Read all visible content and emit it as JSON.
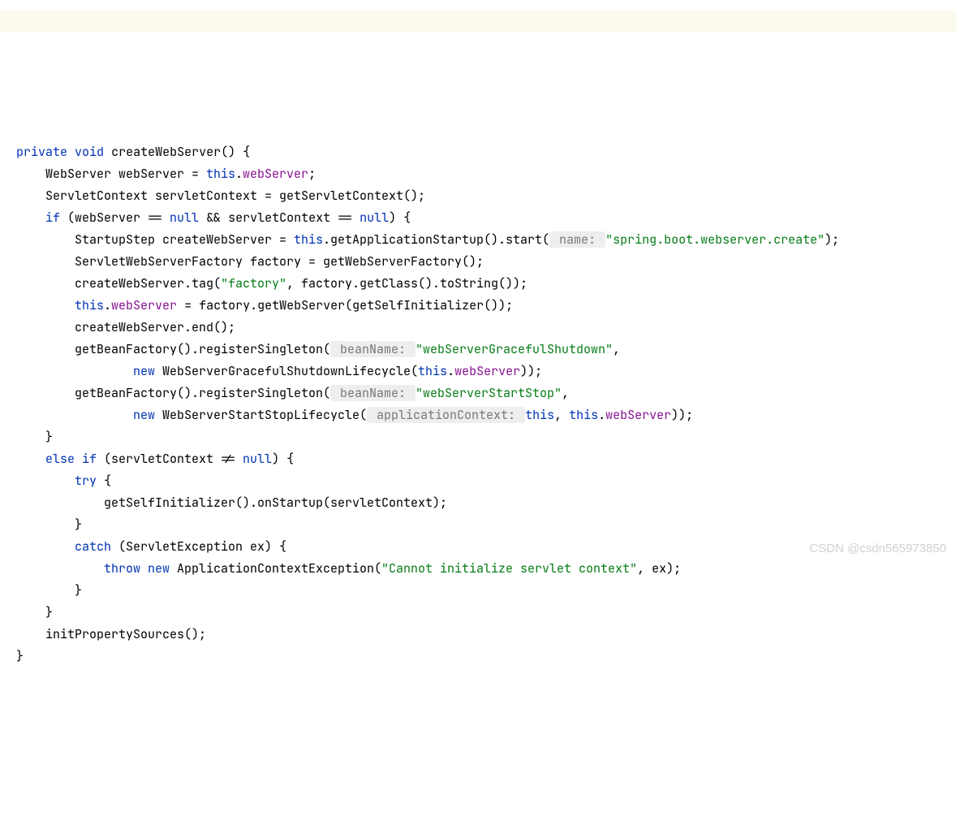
{
  "code": {
    "kw_private": "private",
    "kw_void": "void",
    "method_name": "createWebServer() {",
    "l2_a": "    WebServer webServer = ",
    "l2_kw_this": "this",
    "l2_b": ".",
    "l2_field": "webServer",
    "l2_c": ";",
    "l3": "    ServletContext servletContext = getServletContext();",
    "l4_a": "    ",
    "l4_if": "if",
    "l4_b": " (webServer == ",
    "l4_null1": "null",
    "l4_c": " && servletContext == ",
    "l4_null2": "null",
    "l4_d": ") {",
    "l5_a": "        StartupStep createWebServer = ",
    "l5_this": "this",
    "l5_b": ".getApplicationStartup().start(",
    "l5_hint": " name: ",
    "l5_str": "\"spring.boot.webserver.create\"",
    "l5_c": ");",
    "l6": "        ServletWebServerFactory factory = getWebServerFactory();",
    "l7_a": "        createWebServer.tag(",
    "l7_str": "\"factory\"",
    "l7_b": ", factory.getClass().toString());",
    "l8_a": "        ",
    "l8_this": "this",
    "l8_b": ".",
    "l8_field": "webServer",
    "l8_c": " = factory.getWebServer(getSelfInitializer());",
    "l9": "        createWebServer.end();",
    "l10_a": "        getBeanFactory().registerSingleton(",
    "l10_hint": " beanName: ",
    "l10_str": "\"webServerGracefulShutdown\"",
    "l10_b": ",",
    "l11_a": "                ",
    "l11_new": "new",
    "l11_b": " WebServerGracefulShutdownLifecycle(",
    "l11_this": "this",
    "l11_c": ".",
    "l11_field": "webServer",
    "l11_d": "));",
    "l12_a": "        getBeanFactory().registerSingleton(",
    "l12_hint": " beanName: ",
    "l12_str": "\"webServerStartStop\"",
    "l12_b": ",",
    "l13_a": "                ",
    "l13_new": "new",
    "l13_b": " WebServerStartStopLifecycle(",
    "l13_hint": " applicationContext: ",
    "l13_this1": "this",
    "l13_c": ", ",
    "l13_this2": "this",
    "l13_d": ".",
    "l13_field": "webServer",
    "l13_e": "));",
    "l14": "    }",
    "l15_a": "    ",
    "l15_else": "else if",
    "l15_b": " (servletContext != ",
    "l15_null": "null",
    "l15_c": ") {",
    "l16_a": "        ",
    "l16_try": "try",
    "l16_b": " {",
    "l17": "            getSelfInitializer().onStartup(servletContext);",
    "l18": "        }",
    "l19_a": "        ",
    "l19_catch": "catch",
    "l19_b": " (ServletException ex) {",
    "l20_a": "            ",
    "l20_throw": "throw new",
    "l20_b": " ApplicationContextException(",
    "l20_str": "\"Cannot initialize servlet context\"",
    "l20_c": ", ex);",
    "l21": "        }",
    "l22": "    }",
    "l23": "    initPropertySources();",
    "l24": "}"
  },
  "watermark": "CSDN @csdn565973850"
}
